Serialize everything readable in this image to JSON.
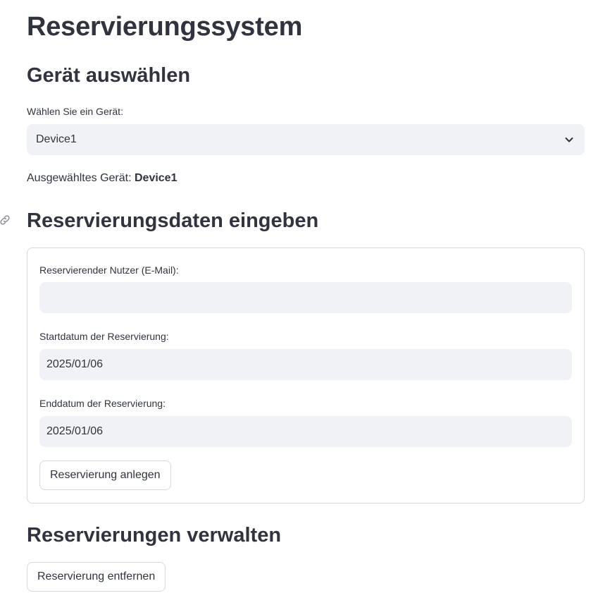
{
  "page": {
    "title": "Reservierungssystem"
  },
  "device_section": {
    "heading": "Gerät auswählen",
    "select_label": "Wählen Sie ein Gerät:",
    "selected_value": "Device1",
    "selected_info_prefix": "Ausgewähltes Gerät:",
    "selected_info_value": "Device1"
  },
  "reservation_form": {
    "heading": "Reservierungsdaten eingeben",
    "email_label": "Reservierender Nutzer (E-Mail):",
    "email_value": "",
    "start_label": "Startdatum der Reservierung:",
    "start_value": "2025/01/06",
    "end_label": "Enddatum der Reservierung:",
    "end_value": "2025/01/06",
    "submit_label": "Reservierung anlegen"
  },
  "manage_section": {
    "heading": "Reservierungen verwalten",
    "remove_label": "Reservierung entfernen"
  },
  "icons": {
    "anchor": "link-icon",
    "dropdown": "chevron-down-icon"
  }
}
